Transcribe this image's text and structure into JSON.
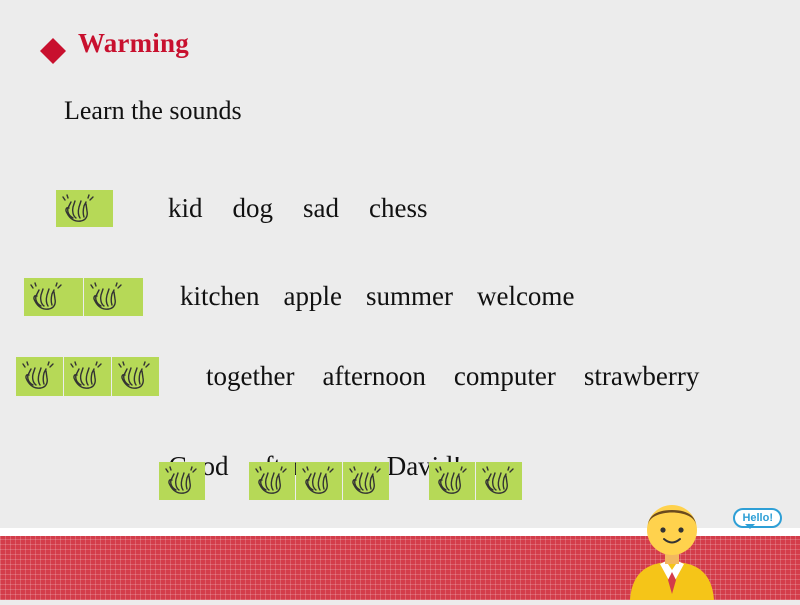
{
  "slide": {
    "title": "Warming",
    "title_marker": "diamond-bullet",
    "subtitle": "Learn the sounds",
    "accent_color": "#c8102e",
    "background_color": "#ececec",
    "footer_color": "#d33c4a",
    "chip_color": "#b6d957"
  },
  "rows": [
    {
      "id": "one-syllable",
      "clap_count": 1,
      "words": [
        "kid",
        "dog",
        "sad",
        "chess"
      ]
    },
    {
      "id": "two-syllable",
      "clap_count": 2,
      "words": [
        "kitchen",
        "apple",
        "summer",
        "welcome"
      ]
    },
    {
      "id": "three-syllable",
      "clap_count": 3,
      "words": [
        "together",
        "afternoon",
        "computer",
        "strawberry"
      ]
    }
  ],
  "sentence": {
    "words": [
      "Good",
      "afternoon,",
      "David!"
    ],
    "clap_clusters": [
      1,
      3,
      2
    ]
  },
  "mascot": {
    "bubble_text": "Hello!"
  }
}
